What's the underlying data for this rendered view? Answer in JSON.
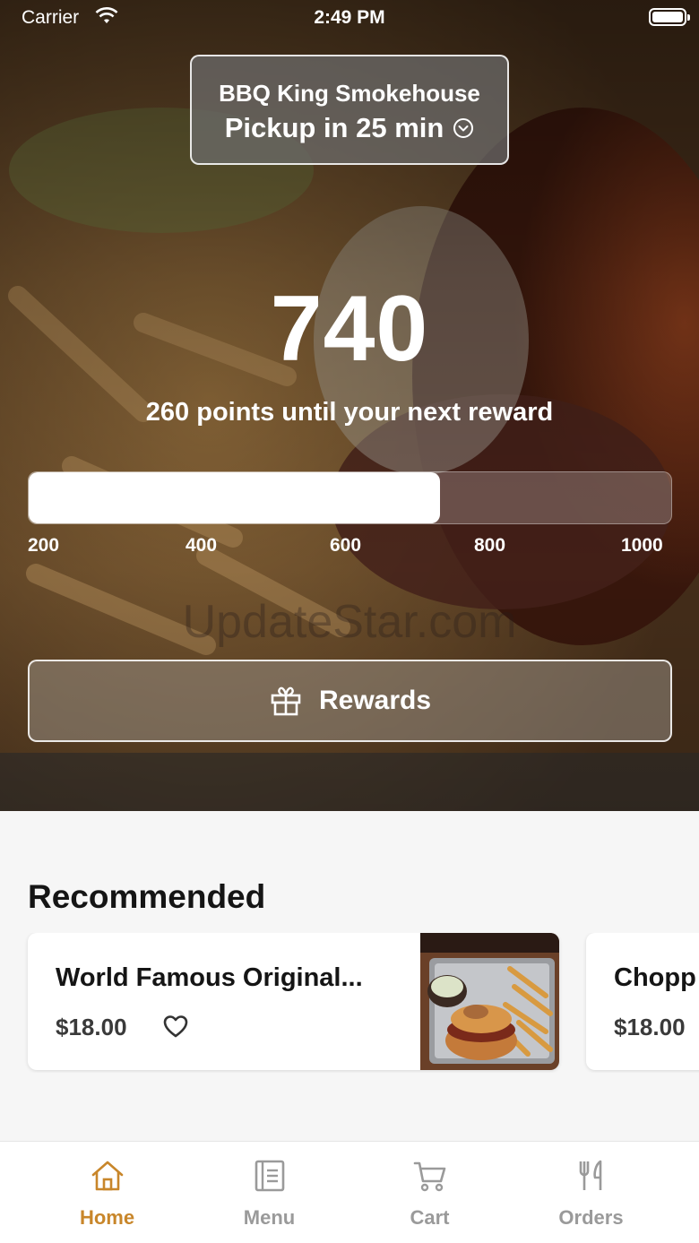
{
  "status_bar": {
    "carrier": "Carrier",
    "time": "2:49 PM"
  },
  "location": {
    "name": "BBQ King Smokehouse",
    "pickup": "Pickup in 25 min"
  },
  "rewards": {
    "points": "740",
    "subtitle": "260 points until your next reward",
    "progress_fraction": 0.64,
    "ticks": [
      "200",
      "400",
      "600",
      "800",
      "1000"
    ],
    "button_label": "Rewards"
  },
  "watermark": "UpdateStar.com",
  "recommended": {
    "title": "Recommended",
    "items": [
      {
        "name": "World Famous Original...",
        "price": "$18.00"
      },
      {
        "name": "Chopp",
        "price": "$18.00"
      }
    ]
  },
  "tabbar": {
    "items": [
      {
        "label": "Home",
        "icon": "home-icon",
        "active": true
      },
      {
        "label": "Menu",
        "icon": "menu-icon",
        "active": false
      },
      {
        "label": "Cart",
        "icon": "cart-icon",
        "active": false
      },
      {
        "label": "Orders",
        "icon": "orders-icon",
        "active": false
      }
    ]
  },
  "colors": {
    "accent": "#c8862a",
    "inactive": "#9a9a9a"
  }
}
